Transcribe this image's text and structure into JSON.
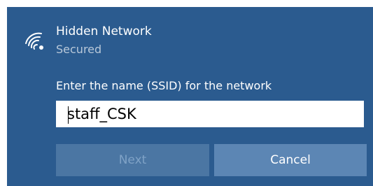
{
  "network": {
    "name": "Hidden Network",
    "status": "Secured",
    "icon": "wifi-icon"
  },
  "ssid_prompt": {
    "label": "Enter the name (SSID) for the network",
    "value": "staff_CSK"
  },
  "buttons": {
    "next_label": "Next",
    "next_enabled": false,
    "cancel_label": "Cancel"
  },
  "colors": {
    "panel_bg": "#2b5b8f",
    "next_bg": "#4b76a3",
    "cancel_bg": "#5c86b4",
    "secondary_text": "#b8c8d9"
  }
}
